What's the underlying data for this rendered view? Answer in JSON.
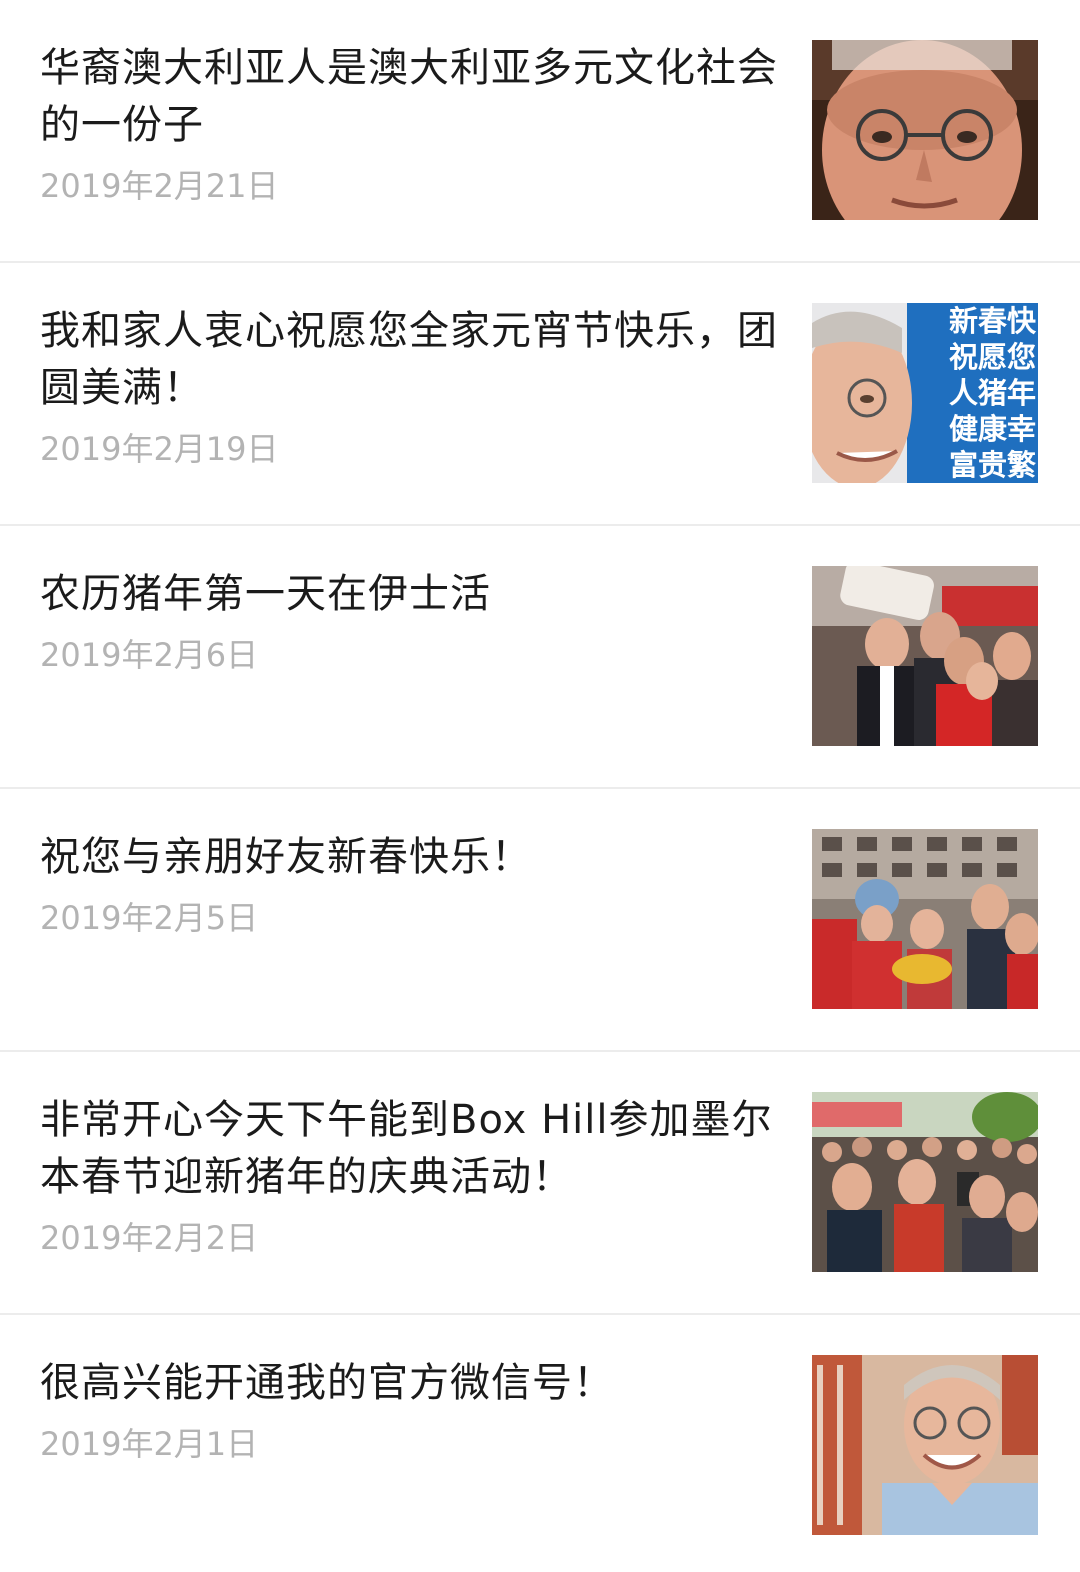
{
  "articles": [
    {
      "title": "华裔澳大利亚人是澳大利亚多元文化社会的一份子",
      "date": "2019年2月21日",
      "thumbnail": "portrait-closeup-photo"
    },
    {
      "title": "我和家人衷心祝愿您全家元宵节快乐，团圆美满！",
      "date": "2019年2月19日",
      "thumbnail": "portrait-blue-banner-photo",
      "thumbnail_text": "新春快\n祝愿您\n人猪年\n健康幸\n富贵繁"
    },
    {
      "title": "农历猪年第一天在伊士活",
      "date": "2019年2月6日",
      "thumbnail": "group-selfie-photo"
    },
    {
      "title": "祝您与亲朋好友新春快乐！",
      "date": "2019年2月5日",
      "thumbnail": "street-celebration-photo"
    },
    {
      "title": "非常开心今天下午能到Box Hill参加墨尔本春节迎新猪年的庆典活动！",
      "date": "2019年2月2日",
      "thumbnail": "crowd-festival-photo"
    },
    {
      "title": "很高兴能开通我的官方微信号！",
      "date": "2019年2月1日",
      "thumbnail": "smiling-portrait-photo"
    }
  ],
  "colors": {
    "title": "#1b1b1b",
    "date": "#b3b3b3",
    "divider": "#ececec",
    "banner_blue": "#1f6fbf"
  }
}
